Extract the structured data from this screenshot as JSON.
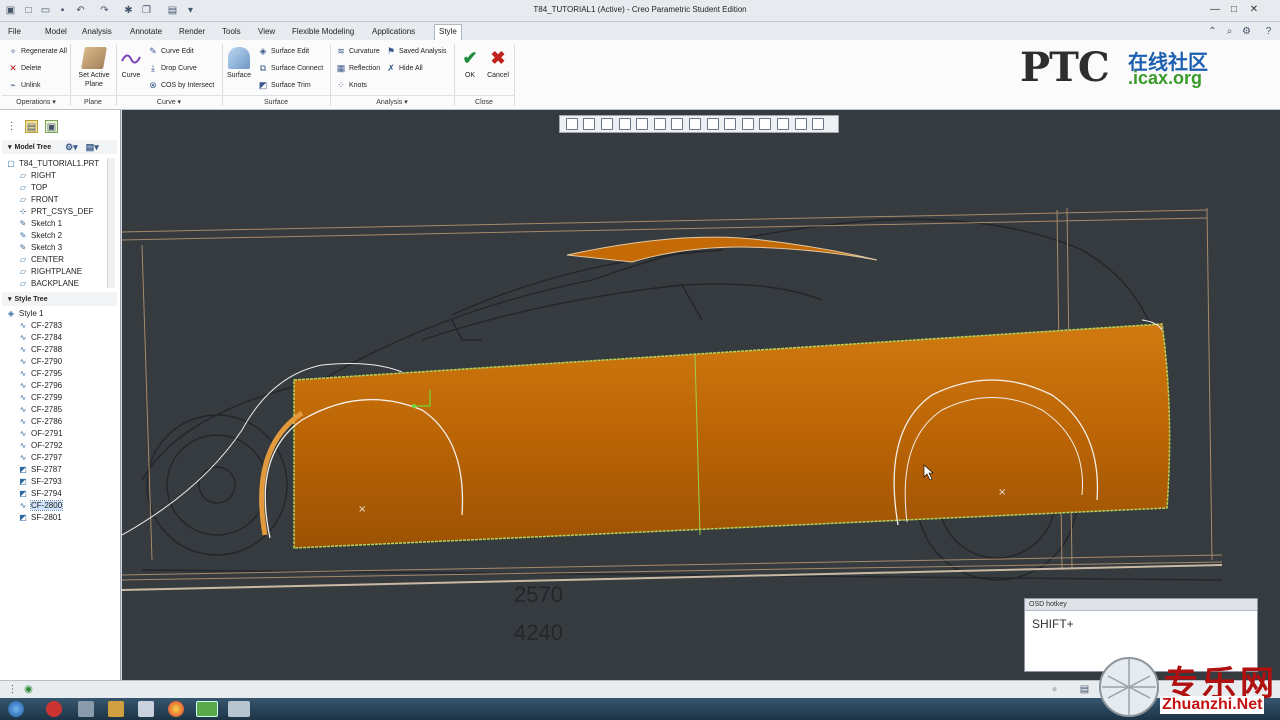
{
  "window": {
    "title": "T84_TUTORIAL1 (Active) - Creo Parametric Student Edition"
  },
  "tabs": [
    {
      "label": "File",
      "active": false
    },
    {
      "label": "Model",
      "active": false
    },
    {
      "label": "Analysis",
      "active": false
    },
    {
      "label": "Annotate",
      "active": false
    },
    {
      "label": "Render",
      "active": false
    },
    {
      "label": "Tools",
      "active": false
    },
    {
      "label": "View",
      "active": false
    },
    {
      "label": "Flexible Modeling",
      "active": false
    },
    {
      "label": "Applications",
      "active": false
    },
    {
      "label": "Style",
      "active": true
    }
  ],
  "ribbon": {
    "regenerate_all": "Regenerate All",
    "delete": "Delete",
    "unlink": "Unlink",
    "set_active_plane": "Set Active Plane",
    "curve": "Curve",
    "curve_edit": "Curve Edit",
    "drop_curve": "Drop Curve",
    "cos_by_intersect": "COS by Intersect",
    "surface": "Surface",
    "surface_edit": "Surface Edit",
    "surface_connect": "Surface Connect",
    "surface_trim": "Surface Trim",
    "curvature": "Curvature",
    "reflection": "Reflection",
    "knots": "Knots",
    "saved_analysis": "Saved Analysis",
    "hide_all": "Hide All",
    "ok": "OK",
    "cancel": "Cancel",
    "groups": {
      "operations": "Operations",
      "plane": "Plane",
      "curve": "Curve",
      "surface": "Surface",
      "analysis": "Analysis",
      "close": "Close"
    }
  },
  "logo": {
    "brand": "PTC",
    "cn": "在线社区",
    "site": ".icax.org"
  },
  "model_tree": {
    "header": "Model Tree",
    "items": [
      "T84_TUTORIAL1.PRT",
      "RIGHT",
      "TOP",
      "FRONT",
      "PRT_CSYS_DEF",
      "Sketch 1",
      "Sketch 2",
      "Sketch 3",
      "CENTER",
      "RIGHTPLANE",
      "BACKPLANE"
    ]
  },
  "style_tree": {
    "header": "Style Tree",
    "root": "Style 1",
    "items": [
      "CF-2783",
      "CF-2784",
      "CF-2788",
      "CF-2790",
      "CF-2795",
      "CF-2796",
      "CF-2799",
      "CF-2785",
      "CF-2786",
      "OF-2791",
      "OF-2792",
      "CF-2797",
      "SF-2787",
      "SF-2793",
      "SF-2794",
      "CF-2800",
      "SF-2801"
    ],
    "selected": "CF-2800"
  },
  "viewport": {
    "dim_a": "2570",
    "dim_b": "4240"
  },
  "osd": {
    "title": "OSD hotkey",
    "value": "SHIFT+"
  },
  "watermark": {
    "cn": "专乐网",
    "site": "Zhuanzhi.Net"
  },
  "colors": {
    "surface": "#c46a06",
    "viewport_bg": "#363b3f",
    "accent_green": "#1e8c3a",
    "cancel_red": "#c0221d"
  }
}
